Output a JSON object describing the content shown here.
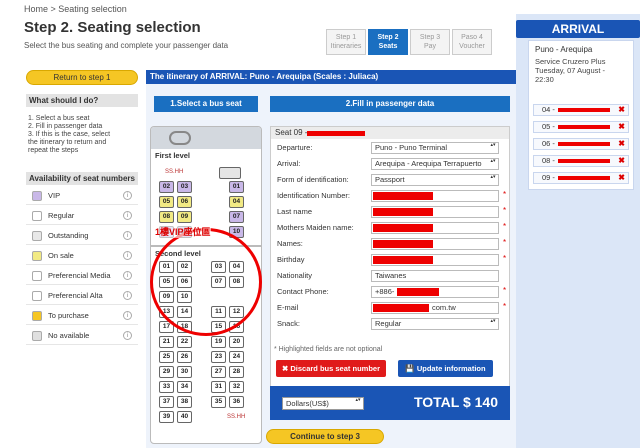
{
  "breadcrumb": "Home > Seating selection",
  "title": "Step 2. Seating selection",
  "subtitle": "Select the bus seating and complete your passenger data",
  "steps": [
    {
      "label": "Step 1",
      "sub": "Itineraries",
      "active": false
    },
    {
      "label": "Step 2",
      "sub": "Seats",
      "active": true
    },
    {
      "label": "Step 3",
      "sub": "Pay",
      "active": false
    },
    {
      "label": "Paso 4",
      "sub": "Voucher",
      "active": false
    }
  ],
  "arrival": {
    "title": "ARRIVAL",
    "route": "Puno - Arequipa",
    "service": "Service Cruzero Plus",
    "date": "Tuesday, 07 August -",
    "time": "22:30",
    "seats": [
      "04 -",
      "05 -",
      "06 -",
      "08 -",
      "09 -"
    ]
  },
  "sidebar": {
    "return_label": "Return to step 1",
    "help_title": "What should I do?",
    "help_items": [
      "1. Select a bus seat",
      "2. Fill in passenger data",
      "3. If this is the case, select",
      "the itinerary to return and",
      "repeat the steps"
    ],
    "availability_title": "Availability of seat numbers",
    "legend": [
      {
        "label": "VIP",
        "color": "#c9b8e8"
      },
      {
        "label": "Regular",
        "color": "#ffffff"
      },
      {
        "label": "Outstanding",
        "color": "#e8e8e8"
      },
      {
        "label": "On sale",
        "color": "#f2ea84"
      },
      {
        "label": "Preferencial Media",
        "color": "#ffffff"
      },
      {
        "label": "Preferencial Alta",
        "color": "#ffffff"
      },
      {
        "label": "To purchase",
        "color": "#f5c624"
      },
      {
        "label": "No available",
        "color": "#e0e0e0"
      }
    ],
    "info_glyph": "i"
  },
  "main": {
    "itinerary_bar": "The itinerary of ARRIVAL: Puno - Arequipa (Scales : Juliaca)",
    "select_bus_label": "1.Select a bus seat",
    "fill_data_label": "2.Fill in passenger data",
    "annotation": "1樓VIP座位區",
    "bus": {
      "first_level": "First level",
      "second_level": "Second level",
      "ss_label": "SS.HH",
      "first_rows": [
        [
          "02",
          "03",
          "",
          "01"
        ],
        [
          "05",
          "06",
          "",
          "04"
        ],
        [
          "08",
          "09",
          "",
          "07"
        ],
        [
          "11",
          "12",
          "",
          "10"
        ]
      ],
      "first_colors": [
        [
          "vip",
          "vip",
          "",
          "vip"
        ],
        [
          "sale",
          "sale",
          "",
          "sale"
        ],
        [
          "sale",
          "sale",
          "",
          "vip"
        ],
        [
          "vip",
          "vip",
          "",
          "vip"
        ]
      ],
      "second_rows": [
        [
          "01",
          "02",
          "03",
          "04"
        ],
        [
          "05",
          "06",
          "07",
          "08"
        ],
        [
          "09",
          "10",
          "",
          ""
        ],
        [
          "13",
          "14",
          "11",
          "12"
        ],
        [
          "17",
          "18",
          "15",
          "16"
        ],
        [
          "21",
          "22",
          "19",
          "20"
        ],
        [
          "25",
          "26",
          "23",
          "24"
        ],
        [
          "29",
          "30",
          "27",
          "28"
        ],
        [
          "33",
          "34",
          "31",
          "32"
        ],
        [
          "37",
          "38",
          "35",
          "36"
        ],
        [
          "39",
          "40",
          "",
          ""
        ]
      ]
    },
    "form": {
      "seat_head": "Seat 09 -",
      "fields": [
        {
          "label": "Departure:",
          "value": "Puno - Puno Terminal",
          "type": "select",
          "req": false,
          "red": 0
        },
        {
          "label": "Arrival:",
          "value": "Arequipa - Arequipa Terrapuerto",
          "type": "select",
          "req": false,
          "red": 0
        },
        {
          "label": "Form of identification:",
          "value": "Passport",
          "type": "select",
          "req": false,
          "red": 0
        },
        {
          "label": "Identification Number:",
          "value": "",
          "type": "text",
          "req": true,
          "red": 60
        },
        {
          "label": "Last name",
          "value": "",
          "type": "text",
          "req": true,
          "red": 60
        },
        {
          "label": "Mothers Maiden name:",
          "value": "",
          "type": "text",
          "req": true,
          "red": 60
        },
        {
          "label": "Names:",
          "value": "",
          "type": "text",
          "req": true,
          "red": 60
        },
        {
          "label": "Birthday",
          "value": "",
          "type": "text",
          "req": true,
          "red": 60
        },
        {
          "label": "Nationality",
          "value": "Taiwanes",
          "type": "text",
          "req": false,
          "red": 0
        },
        {
          "label": "Contact Phone:",
          "value": "+886-",
          "type": "text",
          "req": true,
          "red": 42
        },
        {
          "label": "E-mail",
          "value": "com.tw",
          "type": "text",
          "req": true,
          "red": 56
        },
        {
          "label": "Snack:",
          "value": "Regular",
          "type": "select",
          "req": false,
          "red": 0
        }
      ],
      "required_mark": "*",
      "hint": "* Highlighted fields are not optional",
      "discard_label": "Discard bus seat number",
      "update_label": "Update information",
      "currency": "Dollars(US$)",
      "total": "TOTAL $ 140"
    },
    "continue_label": "Continue to step 3"
  },
  "colors": {
    "primary": "#1a55b5",
    "accent": "#f5c624",
    "danger": "#e01a1a"
  }
}
